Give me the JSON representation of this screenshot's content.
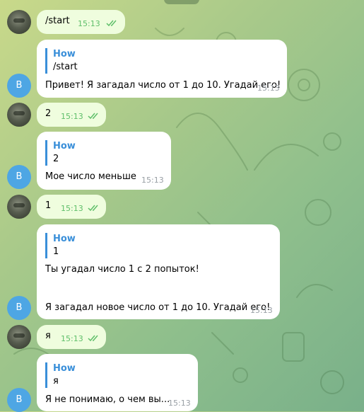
{
  "bot_initial": "В",
  "messages": [
    {
      "text": "/start",
      "time": "15:13"
    },
    {
      "reply_name": "How",
      "reply_text": "/start",
      "text": "Привет! Я загадал число от 1 до 10. Угадай его!",
      "time": "15:13"
    },
    {
      "text": "2",
      "time": "15:13"
    },
    {
      "reply_name": "How",
      "reply_text": "2",
      "text": "Мое число меньше",
      "time": "15:13"
    },
    {
      "text": "1",
      "time": "15:13"
    },
    {
      "reply_name": "How",
      "reply_text": "1",
      "text": "Ты угадал число 1 с 2 попыток!",
      "text2": "Я загадал новое число от 1 до 10. Угадай его!",
      "time": "15:13"
    },
    {
      "text": "я",
      "time": "15:13"
    },
    {
      "reply_name": "How",
      "reply_text": "я",
      "text": "Я не понимаю, о чем вы...",
      "time": "15:13"
    }
  ]
}
